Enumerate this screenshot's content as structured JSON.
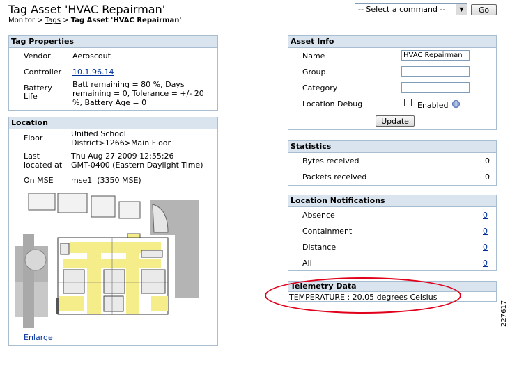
{
  "page": {
    "title": "Tag Asset 'HVAC Repairman'",
    "breadcrumb": {
      "monitor": "Monitor",
      "sep1": ">",
      "tags": "Tags",
      "sep2": ">",
      "current": "Tag Asset 'HVAC Repairman'"
    },
    "command_select": "-- Select a command --",
    "go_label": "Go",
    "figure_id": "227617"
  },
  "tag_properties": {
    "header": "Tag Properties",
    "vendor_label": "Vendor",
    "vendor_value": "Aeroscout",
    "controller_label": "Controller",
    "controller_value": "10.1.96.14",
    "battery_label_1": "Battery",
    "battery_label_2": "Life",
    "battery_line_1": "Batt remaining = 80 %, Days",
    "battery_line_2": "remaining = 0, Tolerance = +/- 20",
    "battery_line_3": "%, Battery Age = 0"
  },
  "location": {
    "header": "Location",
    "floor_label": "Floor",
    "floor_line_1": "Unified School",
    "floor_line_2": "District>1266>Main Floor",
    "last_label_1": "Last",
    "last_label_2": "located at",
    "last_line_1": "Thu Aug 27 2009 12:55:26",
    "last_line_2": "GMT-0400 (Eastern Daylight Time)",
    "mse_label": "On MSE",
    "mse_value": "mse1  (3350 MSE)",
    "enlarge": "Enlarge"
  },
  "asset_info": {
    "header": "Asset Info",
    "name_label": "Name",
    "name_value": "HVAC Repairman",
    "group_label": "Group",
    "group_value": "",
    "category_label": "Category",
    "category_value": "",
    "debug_label": "Location Debug",
    "enabled_label": "Enabled",
    "update_label": "Update"
  },
  "statistics": {
    "header": "Statistics",
    "bytes_label": "Bytes received",
    "bytes_value": "0",
    "packets_label": "Packets received",
    "packets_value": "0"
  },
  "notifications": {
    "header": "Location Notifications",
    "absence_label": "Absence",
    "absence_value": "0",
    "containment_label": "Containment",
    "containment_value": "0",
    "distance_label": "Distance",
    "distance_value": "0",
    "all_label": "All",
    "all_value": "0"
  },
  "telemetry": {
    "header": "Telemetry Data",
    "value": "TEMPERATURE : 20.05 degrees Celsius"
  },
  "colors": {
    "panel_header": "#d9e4ef",
    "panel_border": "#a9bdd0",
    "link": "#00309c",
    "highlight": "#e0001b",
    "floor_yellow": "#f5ec8a"
  }
}
